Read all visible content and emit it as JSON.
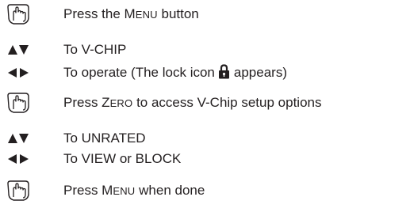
{
  "steps": [
    {
      "icon": "hand-press-icon",
      "parts": [
        "Press the M",
        "ENU",
        " button"
      ]
    },
    {
      "icon": "up-down-arrows-icon",
      "parts": [
        "To V-CHIP"
      ]
    },
    {
      "icon": "left-right-arrows-icon",
      "parts": [
        "To operate (The lock icon",
        "appears)"
      ]
    },
    {
      "icon": "hand-press-icon",
      "parts": [
        "Press Z",
        "ERO",
        " to access V-Chip setup options"
      ]
    },
    {
      "icon": "up-down-arrows-icon",
      "parts": [
        "To UNRATED"
      ]
    },
    {
      "icon": "left-right-arrows-icon",
      "parts": [
        "To VIEW or BLOCK"
      ]
    },
    {
      "icon": "hand-press-icon",
      "parts": [
        "Press M",
        "ENU",
        " when done"
      ]
    }
  ],
  "colors": {
    "text": "#231f20",
    "icon": "#231f20",
    "background": "#ffffff"
  }
}
